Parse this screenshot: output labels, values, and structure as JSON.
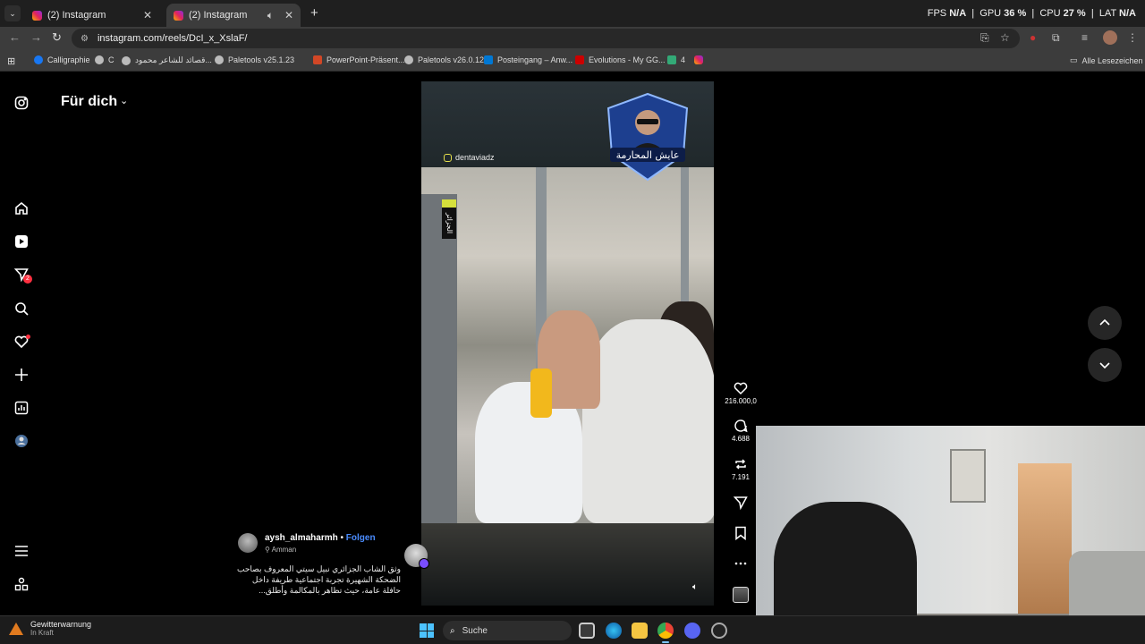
{
  "browser": {
    "tabs": [
      {
        "title": "(2) Instagram"
      },
      {
        "title": "(2) Instagram"
      }
    ],
    "perf": {
      "fps_label": "FPS",
      "fps": "N/A",
      "gpu_label": "GPU",
      "gpu": "36 %",
      "cpu_label": "CPU",
      "cpu": "27 %",
      "lat_label": "LAT",
      "lat": "N/A"
    },
    "url": "instagram.com/reels/DcI_x_XslaF/",
    "bookmarks": [
      {
        "label": "Calligraphie",
        "icon": "facebook-icon"
      },
      {
        "label": "C",
        "icon": "globe-icon"
      },
      {
        "label": "قصائد للشاعر محمود...",
        "icon": "globe-icon"
      },
      {
        "label": "Paletools v25.1.23",
        "icon": "globe-icon"
      },
      {
        "label": "PowerPoint-Präsent...",
        "icon": "powerpoint-icon"
      },
      {
        "label": "Paletools v26.0.12",
        "icon": "globe-icon"
      },
      {
        "label": "Posteingang – Anw...",
        "icon": "outlook-icon"
      },
      {
        "label": "Evolutions - My GG...",
        "icon": "gg-icon"
      },
      {
        "label": "4",
        "icon": "app-icon"
      },
      {
        "label": "",
        "icon": "instagram-icon"
      }
    ],
    "all_bookmarks": "Alle Lesezeichen"
  },
  "instagram": {
    "feed_title": "Für dich",
    "nav": {
      "messages_badge": "2"
    },
    "reel": {
      "overlay_handle": "dentaviadz",
      "geo_tag": "الجزائر",
      "likes": "216.000,0",
      "comments": "4.688",
      "reposts": "7.191",
      "author": "aysh_almaharmh",
      "separator": "•",
      "follow": "Folgen",
      "location": "Amman",
      "caption": "وثق الشاب الجزائري نبيل سيتي المعروف بصاحب الضحكة الشهيرة تجربة اجتماعية طريفة داخل حافلة عامة، حيث تظاهر بالمكالمة وأطلق..."
    }
  },
  "taskbar": {
    "weather_title": "Gewitterwarnung",
    "weather_sub": "In Kraft",
    "search_placeholder": "Suche"
  },
  "colors": {
    "accent_blue": "#4a8cff",
    "notification_red": "#ff3040"
  }
}
